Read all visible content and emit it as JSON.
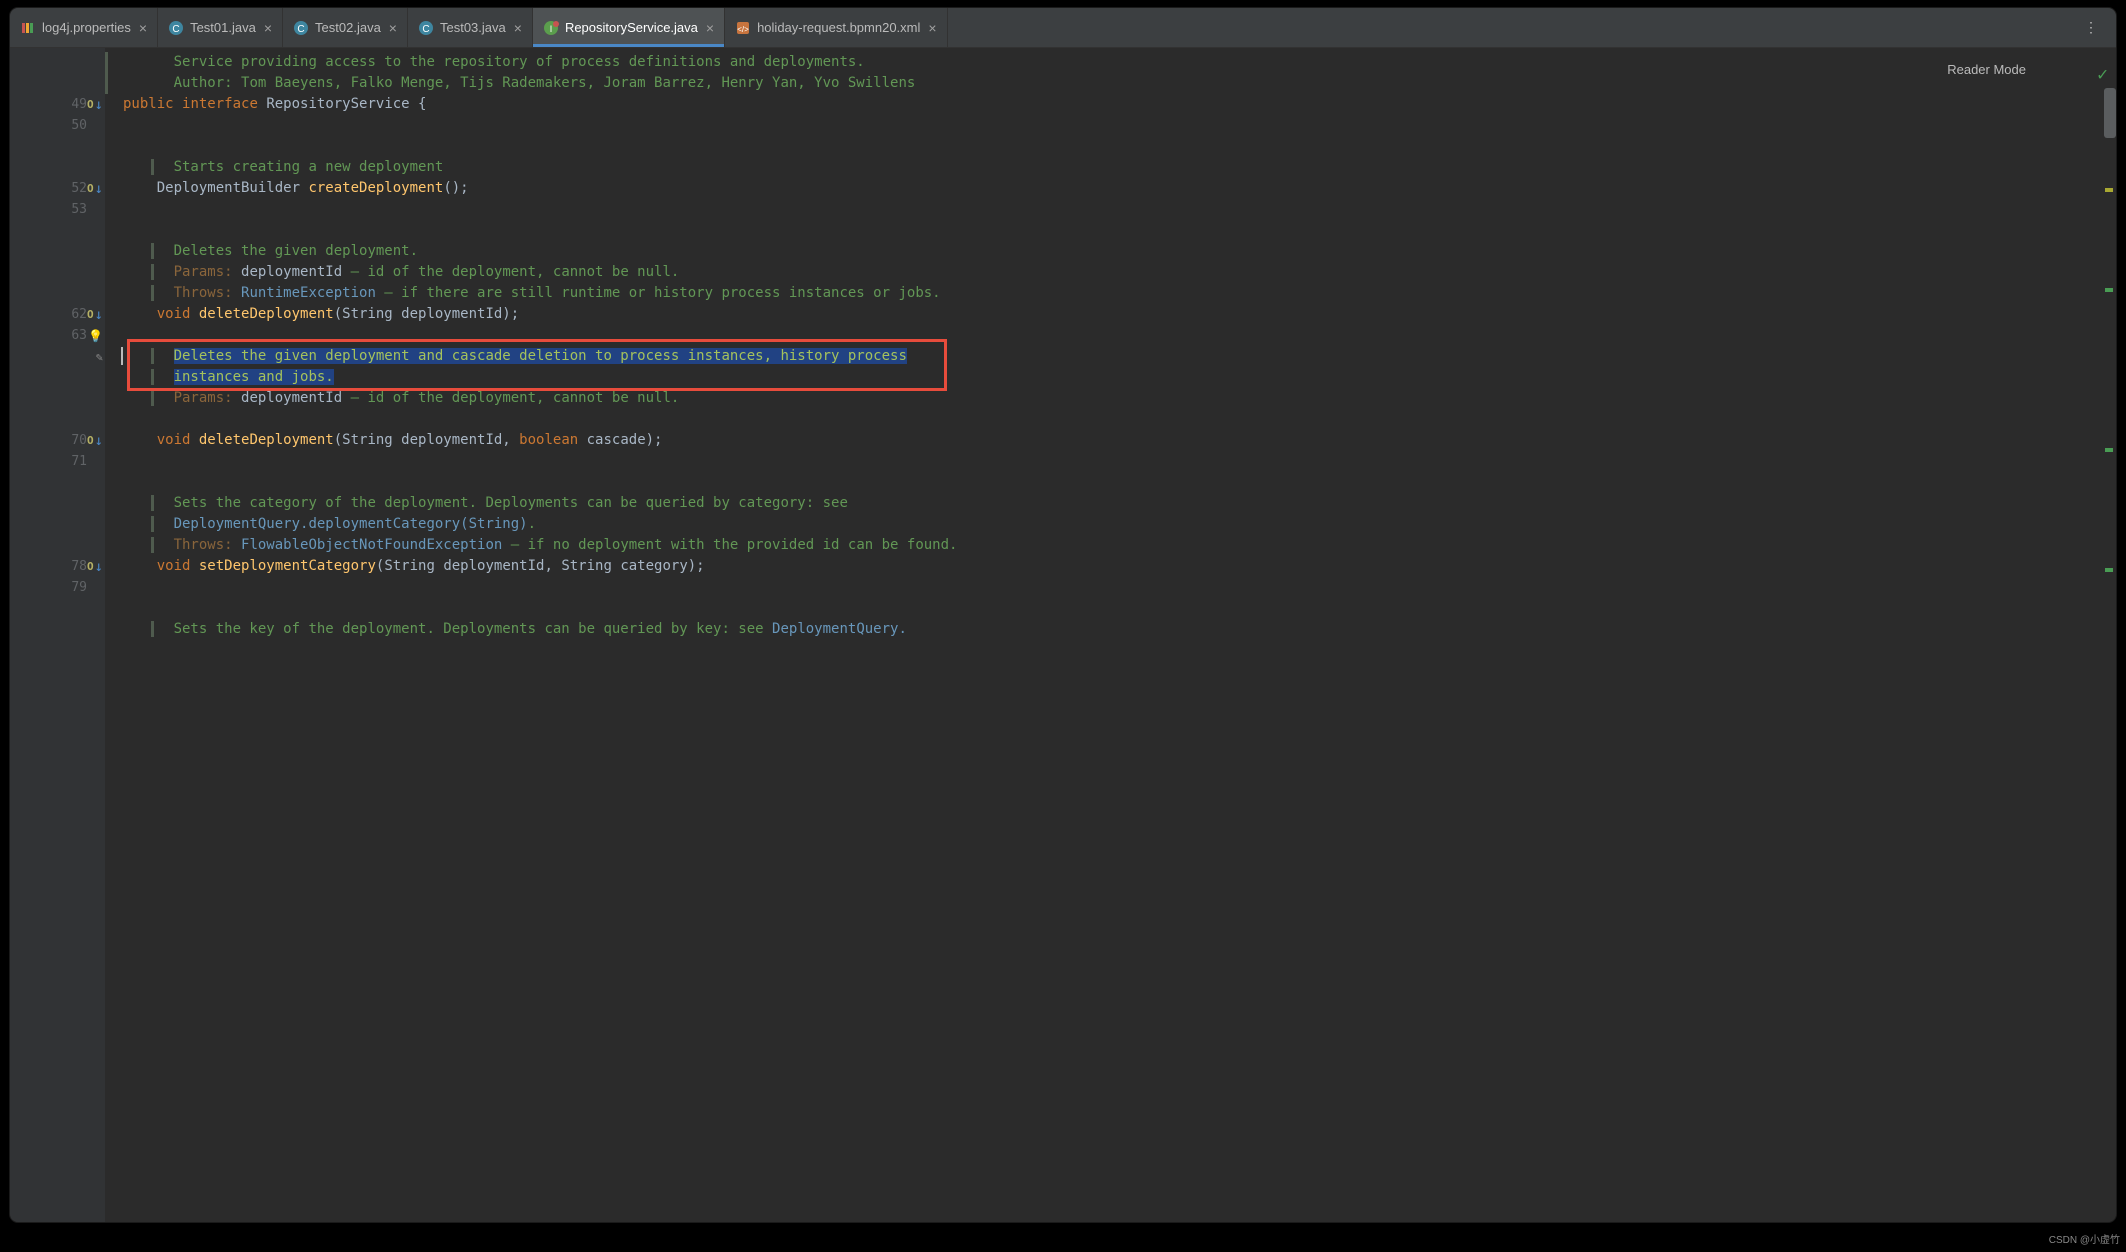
{
  "tabs": [
    {
      "label": "log4j.properties",
      "icon": "props",
      "active": false
    },
    {
      "label": "Test01.java",
      "icon": "java",
      "active": false
    },
    {
      "label": "Test02.java",
      "icon": "java",
      "active": false
    },
    {
      "label": "Test03.java",
      "icon": "java",
      "active": false
    },
    {
      "label": "RepositoryService.java",
      "icon": "interface",
      "active": true
    },
    {
      "label": "holiday-request.bpmn20.xml",
      "icon": "xml",
      "active": false
    }
  ],
  "readerMode": "Reader Mode",
  "gutter": {
    "49": {
      "override": true,
      "arrow": true
    },
    "50": {},
    "52": {
      "override": true,
      "arrow": true
    },
    "53": {},
    "62": {
      "override": true,
      "arrow": true
    },
    "63": {
      "bulb": true
    },
    "pencilRow": {
      "pencil": true
    },
    "70": {
      "override": true,
      "arrow": true
    },
    "71": {},
    "78": {
      "override": true,
      "arrow": true
    },
    "79": {}
  },
  "code": {
    "doc1_l1": "Service providing access to the repository of process definitions and deployments.",
    "doc1_l2_pre": "Author: ",
    "doc1_l2_authors": "Tom Baeyens, Falko Menge, Tijs Rademakers, Joram Barrez, Henry Yan, Yvo Swillens",
    "l49_kw1": "public",
    "l49_kw2": "interface",
    "l49_name": "RepositoryService",
    "l49_brace": " {",
    "doc2": "Starts creating a new deployment",
    "l52_type": "DeploymentBuilder",
    "l52_method": "createDeployment",
    "l52_after": "();",
    "doc3_l1": "Deletes the given deployment.",
    "doc3_l2_label": "Params: ",
    "doc3_l2_param": "deploymentId",
    "doc3_l2_rest": " – id of the deployment, cannot be null.",
    "doc3_l3_label": "Throws: ",
    "doc3_l3_ex": "RuntimeException",
    "doc3_l3_rest": " – if there are still runtime or history process instances or jobs.",
    "l62_kw": "void",
    "l62_method": "deleteDeployment",
    "l62_sig1": "(String deploymentId);",
    "doc4_l1a": "Deletes the given deployment and cascade deletion to process instances, history process",
    "doc4_l1b": "instances and jobs.",
    "doc4_l2_label": "Params: ",
    "doc4_l2_param": "deploymentId",
    "doc4_l2_rest": " – id of the deployment, cannot be null.",
    "l70_kw": "void",
    "l70_method": "deleteDeployment",
    "l70_sig": "(String deploymentId, ",
    "l70_kw2": "boolean",
    "l70_sig2": " cascade);",
    "doc5_l1": "Sets the category of the deployment. Deployments can be queried by category: see",
    "doc5_l2_link": "DeploymentQuery.deploymentCategory(String)",
    "doc5_l2_after": ".",
    "doc5_l3_label": "Throws: ",
    "doc5_l3_ex": "FlowableObjectNotFoundException",
    "doc5_l3_rest": " – if no deployment with the provided id can be found.",
    "l78_kw": "void",
    "l78_method": "setDeploymentCategory",
    "l78_sig": "(String deploymentId, String category);",
    "doc6_l1_pre": "Sets the key of the deployment. Deployments can be queried by key: see ",
    "doc6_l1_link": "DeploymentQuery.",
    "indent1": "    ",
    "indent2": "        ",
    "docindent": "      "
  },
  "watermark": "CSDN @小虚竹"
}
